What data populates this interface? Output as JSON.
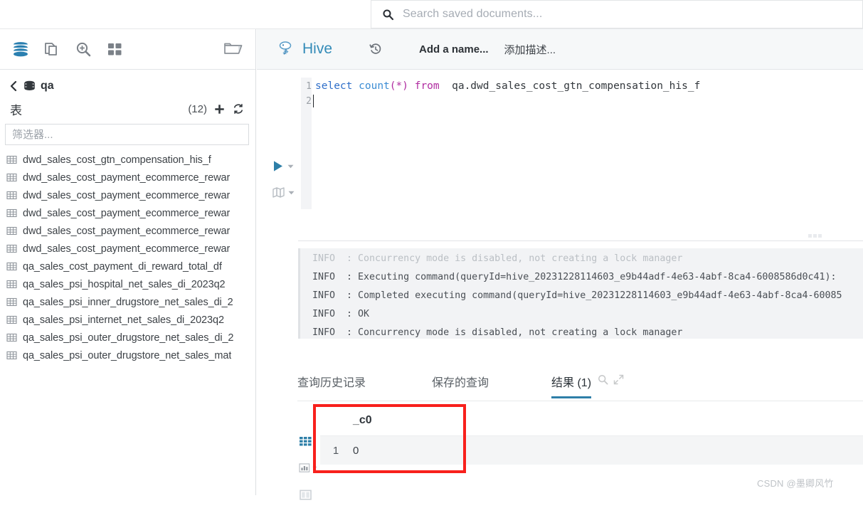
{
  "search": {
    "placeholder": "Search saved documents...",
    "icon": "search-icon"
  },
  "left_panel": {
    "toolbar_icons": [
      "database-icon",
      "documents-icon",
      "zoom-in-icon",
      "grid-apps-icon",
      "open-folder-icon"
    ],
    "breadcrumb": {
      "back_icon": "chevron-left-icon",
      "db_icon": "database-icon",
      "db_name": "qa"
    },
    "tables_section": {
      "title": "表",
      "count": "(12)",
      "add_icon": "plus-icon",
      "refresh_icon": "refresh-icon",
      "filter_placeholder": "筛选器...",
      "filter_value": ""
    },
    "tables": [
      "dwd_sales_cost_gtn_compensation_his_f",
      "dwd_sales_cost_payment_ecommerce_rewar",
      "dwd_sales_cost_payment_ecommerce_rewar",
      "dwd_sales_cost_payment_ecommerce_rewar",
      "dwd_sales_cost_payment_ecommerce_rewar",
      "dwd_sales_cost_payment_ecommerce_rewar",
      "qa_sales_cost_payment_di_reward_total_df",
      "qa_sales_psi_hospital_net_sales_di_2023q2",
      "qa_sales_psi_inner_drugstore_net_sales_di_2",
      "qa_sales_psi_internet_net_sales_di_2023q2",
      "qa_sales_psi_outer_drugstore_net_sales_di_2",
      "qa_sales_psi_outer_drugstore_net_sales_mat"
    ]
  },
  "editor_header": {
    "logo_icon": "hive-logo-icon",
    "title": "Hive",
    "history_icon": "history-icon",
    "name_placeholder": "Add a name...",
    "description_placeholder": "添加描述..."
  },
  "editor": {
    "run_icon": "play-icon",
    "run_caret_icon": "chevron-down-icon",
    "explain_icon": "map-icon",
    "explain_caret_icon": "chevron-down-icon",
    "line_numbers": [
      "1",
      "2"
    ],
    "sql": {
      "full": "select count(*) from  qa.dwd_sales_cost_gtn_compensation_his_f",
      "tokens": {
        "select": "select",
        "count": "count",
        "paren_star": "(*)",
        "from": "from",
        "table": "qa.dwd_sales_cost_gtn_compensation_his_f"
      }
    }
  },
  "logs": {
    "drag_handle_icon": "drag-handle-icon",
    "lines": [
      "INFO  : Concurrency mode is disabled, not creating a lock manager",
      "INFO  : Executing command(queryId=hive_20231228114603_e9b44adf-4e63-4abf-8ca4-6008586d0c41):",
      "INFO  : Completed executing command(queryId=hive_20231228114603_e9b44adf-4e63-4abf-8ca4-60085",
      "INFO  : OK",
      "INFO  : Concurrency mode is disabled, not creating a lock manager"
    ]
  },
  "result_tabs": {
    "items": [
      {
        "label": "查询历史记录",
        "active": false
      },
      {
        "label": "保存的查询",
        "active": false
      },
      {
        "label": "结果 (1)",
        "active": true
      }
    ],
    "tools": [
      "search-icon",
      "expand-icon"
    ]
  },
  "result_view_icons": [
    "table-view-icon",
    "chart-view-icon",
    "chart-view-caret-icon",
    "columns-view-icon"
  ],
  "result_grid": {
    "columns": [
      "_c0"
    ],
    "rows": [
      {
        "index": "1",
        "values": [
          "0"
        ]
      }
    ]
  },
  "highlight": {
    "color": "#f8201c"
  },
  "watermark": "CSDN @墨卿风竹"
}
